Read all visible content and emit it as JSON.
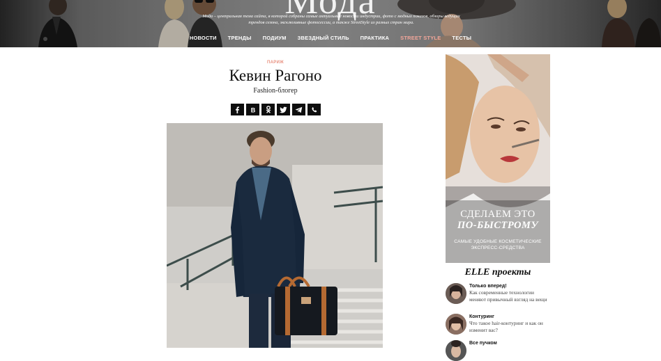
{
  "header": {
    "logo": "Мода",
    "tagline": "Мода – центральная тема сайта, в которой собраны самые актуальные новости индустрии, фото с модных показов, обзоры ведущих трендов сезона, эксклюзивные фотосессии, а также StreetStyle из разных стран мира.",
    "nav": [
      "НОВОСТИ",
      "ТРЕНДЫ",
      "ПОДИУМ",
      "ЗВЕЗДНЫЙ СТИЛЬ",
      "ПРАКТИКА",
      "STREET STYLE",
      "ТЕСТЫ"
    ],
    "nav_active": "STREET STYLE",
    "accent_color": "#f3a69a"
  },
  "article": {
    "kicker": "ПАРИЖ",
    "title": "Кевин Рагоно",
    "subtitle": "Fashion-блогер",
    "share_icons": [
      "facebook-icon",
      "vk-icon",
      "odnoklassniki-icon",
      "twitter-icon",
      "telegram-icon",
      "viber-icon"
    ]
  },
  "sidebar": {
    "ad": {
      "line1": "СДЕЛАЕМ ЭТО",
      "line2": "ПО-БЫСТРОМУ",
      "sub": "САМЫЕ УДОБНЫЕ КОСМЕТИЧЕСКИЕ ЭКСПРЕСС-СРЕДСТВА"
    },
    "projects_title": "ELLE проекты",
    "projects": [
      {
        "title": "Только вперед!",
        "desc": "Как современные технологии меняют привычный взгляд на вещи"
      },
      {
        "title": "Контуринг",
        "desc": "Что такое hair-контуринг и как он изменит вас?"
      },
      {
        "title": "Все пучком",
        "desc": ""
      }
    ]
  }
}
